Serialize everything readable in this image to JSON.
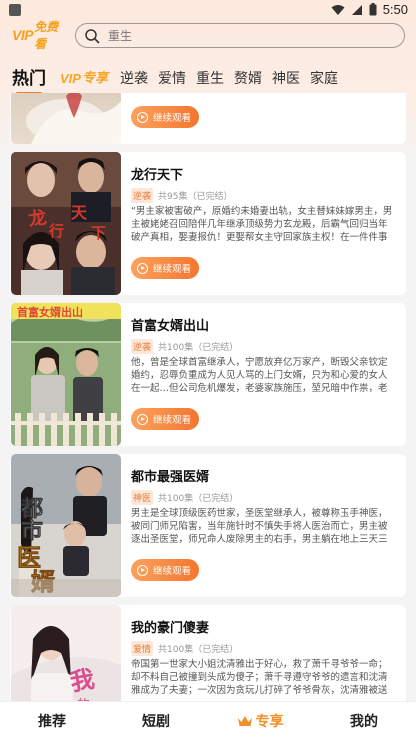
{
  "status": {
    "time": "5:50"
  },
  "header": {
    "logo_vip": "VIP",
    "logo_app": "免费看",
    "search_placeholder": "重生"
  },
  "tabs": [
    {
      "label": "热门",
      "active": true
    },
    {
      "label": "专享",
      "vip": true,
      "prefix": "VIP"
    },
    {
      "label": "逆袭"
    },
    {
      "label": "爱情"
    },
    {
      "label": "重生"
    },
    {
      "label": "赘婿"
    },
    {
      "label": "神医"
    },
    {
      "label": "家庭"
    }
  ],
  "watch_label": "继续观看",
  "dramas": [
    {
      "title": "",
      "genre": "",
      "episodes": "",
      "description": "",
      "partial": true
    },
    {
      "title": "龙行天下",
      "genre": "逆袭",
      "episodes": "共95集（已完结）",
      "description": "“男主家被害破产，原婚约未婚妻出轨，女主替妹妹嫁男主，男主被姥姥召回陪伴几年继承顶级势力玄龙殿，后霸气回归当年破产真相，娶妻报仇！更娶帮女主守回家族主权！在一件件事件的…"
    },
    {
      "title": "首富女婿出山",
      "genre": "逆袭",
      "episodes": "共100集（已完结）",
      "description": "他，曾是全球首富继承人，宁愿放弃亿万家产，断毁父亲钦定婚约，忍辱负重成为人见人骂的上门女婿，只为和心爱的女人在一起…但公司危机爆发，老婆家族施压，堃兄暗中作祟，老婆即将…"
    },
    {
      "title": "都市最强医婿",
      "genre": "神医",
      "episodes": "共100集（已完结）",
      "description": "男主是全球顶级医药世家，圣医堂继承人，被尊称玉手神医，被同门师兄陷害，当年施针时不慎失手将人医治而亡，男主被逐出圣医堂，师兄命人废除男主的右手，男主躺在地上三天三夜，被…"
    },
    {
      "title": "我的豪门傻妻",
      "genre": "爱情",
      "episodes": "共100集（已完结）",
      "description": "帝国第一世家大小姐沈清雅出于好心，救了萧千寻爷爷一命；却不料自己被撞到头成为傻子；萧千寻遵守爷爷的遗言和沈清雅成为了夫妻；一次因为贪玩儿打碎了爷爷骨灰，沈清雅被送往乡下…"
    }
  ],
  "bottom_nav": [
    {
      "label": "推荐"
    },
    {
      "label": "短剧"
    },
    {
      "label": "专享",
      "active": true
    },
    {
      "label": "我的"
    }
  ]
}
